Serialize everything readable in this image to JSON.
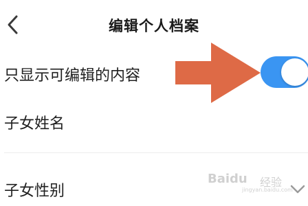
{
  "header": {
    "title": "编辑个人档案",
    "back_icon": "chevron-left-icon"
  },
  "settings": {
    "only_editable": {
      "label": "只显示可编辑的内容",
      "enabled": true,
      "accent_color": "#3a95f2"
    }
  },
  "fields": {
    "child_name": {
      "label": "子女姓名"
    },
    "child_gender": {
      "label": "子女性别"
    }
  },
  "annotation": {
    "arrow_color": "#de6a46"
  },
  "watermark": {
    "brand": "Baidu",
    "name": "经验",
    "url": "jingyan.baidu.com"
  }
}
